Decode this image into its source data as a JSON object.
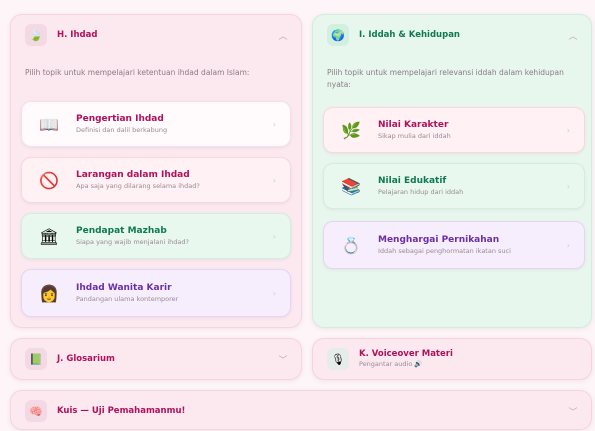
{
  "ihdad": {
    "title": "H. Ihdad",
    "intro": "Pilih topik untuk mempelajari ketentuan ihdad dalam Islam:",
    "cards": [
      {
        "title": "Pengertian Ihdad",
        "subtitle": "Definisi dan dalil berkabung",
        "icon": "open-book-icon",
        "glyph": "📖"
      },
      {
        "title": "Larangan dalam Ihdad",
        "subtitle": "Apa saja yang dilarang selama ihdad?",
        "icon": "prohibited-icon",
        "glyph": "🚫"
      },
      {
        "title": "Pendapat Mazhab",
        "subtitle": "Siapa yang wajib menjalani ihdad?",
        "icon": "house-icon",
        "glyph": "🏛"
      },
      {
        "title": "Ihdad Wanita Karir",
        "subtitle": "Pandangan ulama kontemporer",
        "icon": "working-woman-icon",
        "glyph": "👩"
      }
    ]
  },
  "iddah": {
    "title": "I. Iddah & Kehidupan",
    "intro": "Pilih topik untuk mempelajari relevansi iddah dalam kehidupan nyata:",
    "cards": [
      {
        "title": "Nilai Karakter",
        "subtitle": "Sikap mulia dari iddah",
        "icon": "plant-icon",
        "glyph": "🌿"
      },
      {
        "title": "Nilai Edukatif",
        "subtitle": "Pelajaran hidup dari iddah",
        "icon": "books-icon",
        "glyph": "📚"
      },
      {
        "title": "Menghargai Pernikahan",
        "subtitle": "Iddah sebagai penghormatan ikatan suci",
        "icon": "ring-icon",
        "glyph": "💍"
      }
    ]
  },
  "glosarium": {
    "title": "J. Glosarium",
    "glyph": "📗"
  },
  "voiceover": {
    "title": "K. Voiceover Materi",
    "subtitle": "Pengantar audio 🔊",
    "glyph": "🎙"
  },
  "kuis": {
    "title": "Kuis — Uji Pemahamanmu!",
    "glyph": "🧠"
  }
}
